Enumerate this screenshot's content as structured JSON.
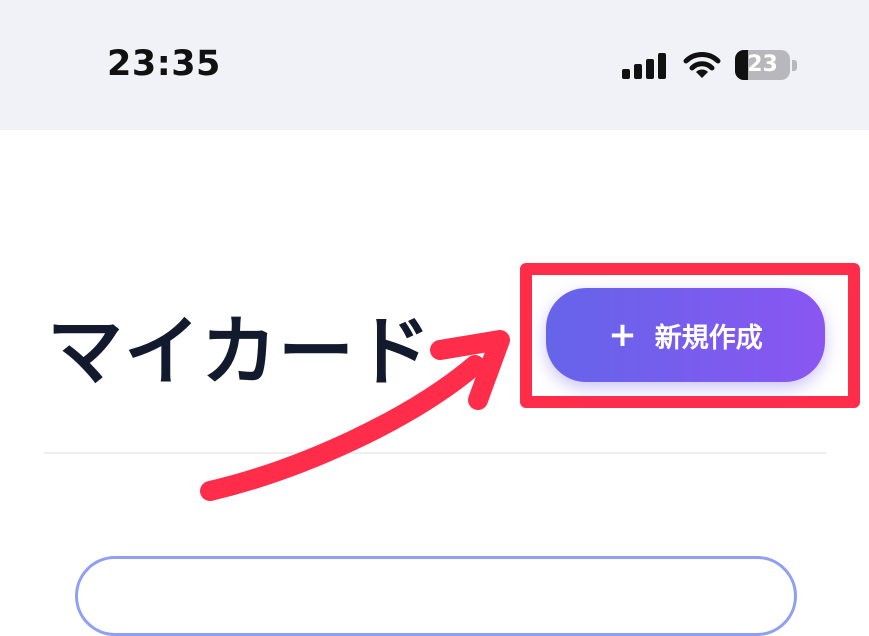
{
  "status_bar": {
    "time": "23:35",
    "battery_level": "23",
    "battery_fraction": 0.23,
    "icons": [
      "signal-icon",
      "wifi-icon",
      "battery-icon"
    ]
  },
  "page": {
    "title": "マイカード",
    "new_button": {
      "icon": "plus-icon",
      "icon_glyph": "+",
      "label": "新規作成"
    }
  },
  "colors": {
    "status_bar_bg": "#f1f2f7",
    "title": "#131a2e",
    "button_gradient_start": "#6564e9",
    "button_gradient_end": "#8a56f2",
    "annotation": "#ff2d4a"
  }
}
